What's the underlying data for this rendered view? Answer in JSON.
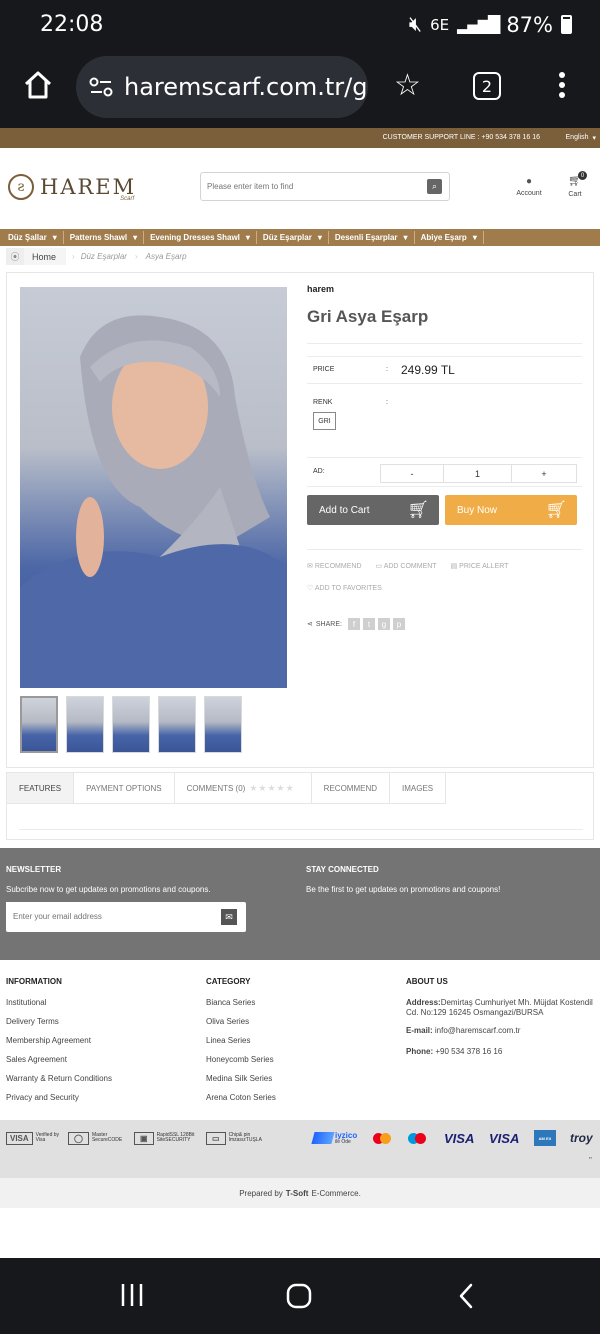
{
  "status_bar": {
    "time": "22:08",
    "battery": "87%",
    "network": "6E"
  },
  "browser": {
    "url": "haremscarf.com.tr/g",
    "tab_count": "2"
  },
  "site_top": {
    "support": "CUSTOMER SUPPORT LINE : +90 534 378 16 16",
    "language": "English"
  },
  "header": {
    "logo_text": "HAREM",
    "logo_sub": "Scarf",
    "search_placeholder": "Please enter item to find",
    "account_label": "Account",
    "cart_label": "Cart",
    "cart_count": "0"
  },
  "categories": [
    "Düz Şallar",
    "Patterns Shawl",
    "Evening Dresses Shawl",
    "Düz Eşarplar",
    "Desenli Eşarplar",
    "Abiye Eşarp"
  ],
  "breadcrumb": {
    "home": "Home",
    "level1": "Düz Eşarplar",
    "level2": "Asya Eşarp"
  },
  "product": {
    "brand": "harem",
    "title": "Gri Asya Eşarp",
    "price_label": "PRICE",
    "price": "249.99 TL",
    "color_label": "RENK",
    "color_option": "GRI",
    "qty_label": "AD:",
    "qty_minus": "-",
    "qty_value": "1",
    "qty_plus": "+",
    "add_to_cart": "Add to Cart",
    "buy_now": "Buy Now",
    "actions": [
      "RECOMMEND",
      "ADD COMMENT",
      "PRICE ALLERT"
    ],
    "favorites": "ADD TO FAVORITES",
    "share_label": "SHARE:",
    "colon": ":"
  },
  "tabs": [
    "FEATURES",
    "PAYMENT OPTIONS",
    "COMMENTS (0)",
    "RECOMMEND",
    "IMAGES"
  ],
  "newsletter": {
    "title": "NEWSLETTER",
    "text": "Subcribe now to get updates on promotions and coupons.",
    "placeholder": "Enter your email address",
    "stay_title": "STAY CONNECTED",
    "stay_text": "Be the first to get updates on promotions and coupons!"
  },
  "footer": {
    "info_title": "INFORMATION",
    "info_links": [
      "Institutional",
      "Delivery Terms",
      "Membership Agreement",
      "Sales Agreement",
      "Warranty & Return Conditions",
      "Privacy and Security"
    ],
    "cat_title": "CATEGORY",
    "cat_links": [
      "Bianca Series",
      "Oliva Series",
      "Linea Series",
      "Honeycomb Series",
      "Medina Silk Series",
      "Arena Coton Series"
    ],
    "about_title": "ABOUT US",
    "address_label": "Address:",
    "address": "Demirtaş Cumhuriyet Mh. Müjdat Kostendil Cd. No:129 16245 Osmangazi/BURSA",
    "email_label": "E-mail:",
    "email": "info@haremscarf.com.tr",
    "phone_label": "Phone:",
    "phone": "+90 534 378 16 16"
  },
  "payments": {
    "badges": [
      {
        "logo": "VISA",
        "text": "Verified by Visa"
      },
      {
        "logo": "◯",
        "text": "Master SecureCODE"
      },
      {
        "logo": "▣",
        "text": "RapidSSL 128Bit SiteSECURITY"
      },
      {
        "logo": "▭",
        "text": "Chip& pin ImzasızTUŞLA"
      }
    ],
    "iyzico": "iyzico",
    "iyzico_sub": "ile Öde",
    "visa1": "VISA",
    "visa2": "VISA",
    "troy": "troy",
    "quote": "\""
  },
  "prepared": {
    "prefix": "Prepared by",
    "brand": "T-Soft",
    "suffix": "E-Commerce."
  }
}
